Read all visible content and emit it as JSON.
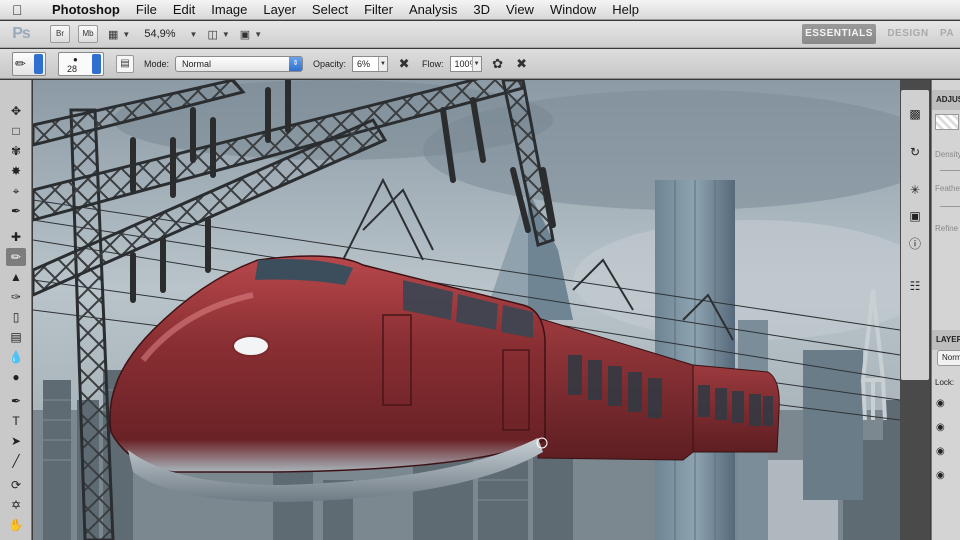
{
  "menubar": {
    "apple": "",
    "items": [
      "Photoshop",
      "File",
      "Edit",
      "Image",
      "Layer",
      "Select",
      "Filter",
      "Analysis",
      "3D",
      "View",
      "Window",
      "Help"
    ]
  },
  "appbar": {
    "logo": "Ps",
    "btn_br": "Br",
    "btn_mb": "Mb",
    "zoom": "54,9%",
    "workspaces": [
      "ESSENTIALS",
      "DESIGN",
      "PA"
    ]
  },
  "options": {
    "brush_size": "28",
    "mode_label": "Mode:",
    "mode_value": "Normal",
    "opacity_label": "Opacity:",
    "opacity_value": "6%",
    "flow_label": "Flow:",
    "flow_value": "100%"
  },
  "panels": {
    "adjustments_tab": "ADJUS",
    "density": "Density",
    "feather": "Feathe",
    "refine": "Refine",
    "layers_tab": "LAYER",
    "blend": "Norm",
    "lock": "Lock:"
  },
  "colors": {
    "train": "#8a2f33",
    "sky": "#a9b6be",
    "accent": "#2f6fd0"
  }
}
